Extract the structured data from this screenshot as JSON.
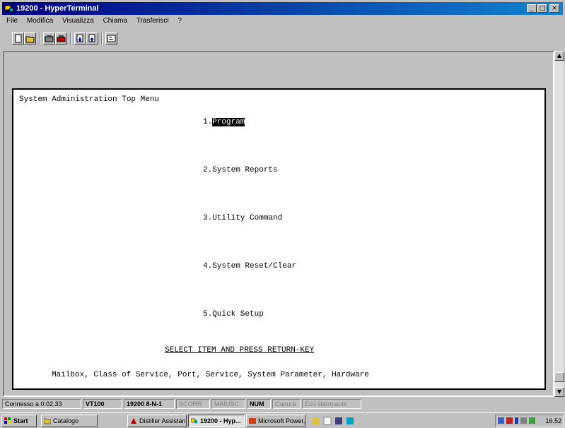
{
  "window": {
    "title": "19200 - HyperTerminal"
  },
  "menu": [
    "File",
    "Modifica",
    "Visualizza",
    "Chiama",
    "Trasferisci",
    "?"
  ],
  "terminal": {
    "header": "System Administration Top Menu",
    "items": [
      {
        "number": "1.",
        "label": "Program"
      },
      {
        "number": "2.",
        "label": "System Reports"
      },
      {
        "number": "3.",
        "label": "Utility Command"
      },
      {
        "number": "4.",
        "label": "System Reset/Clear"
      },
      {
        "number": "5.",
        "label": "Quick Setup"
      }
    ],
    "prompt": "SELECT ITEM AND PRESS RETURN-KEY",
    "help": "Mailbox, Class of Service, Port, Service, System Parameter, Hardware"
  },
  "status": [
    "Connesso a 0.02.33",
    "VT100",
    "19200 8-N-1",
    "SCORR",
    "MAIUSC",
    "NUM",
    "Cattura",
    "Eco stampante"
  ],
  "taskbar": {
    "start": "Start",
    "tasks": [
      "Catalogo",
      "Distiller Assistan...",
      "19200 - Hyp...",
      "Microsoft Power..."
    ],
    "clock": "16.52"
  },
  "colors": {
    "title_left": "#000080",
    "title_right": "#1084d0",
    "chrome": "#c0c0c0"
  }
}
